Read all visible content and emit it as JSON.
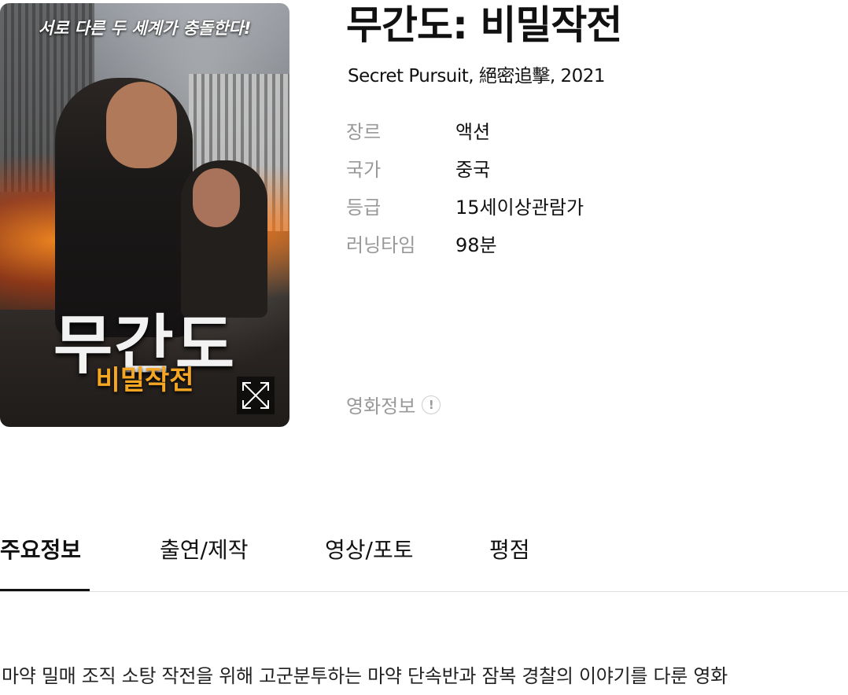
{
  "poster": {
    "tagline": "서로 다른 두 세계가 충돌한다!",
    "logo_main": "무간도",
    "logo_sub": "비밀작전"
  },
  "movie": {
    "title": "무간도: 비밀작전",
    "subtitle": "Secret Pursuit, 絕密追擊, 2021",
    "details": [
      {
        "label": "장르",
        "value": "액션"
      },
      {
        "label": "국가",
        "value": "중국"
      },
      {
        "label": "등급",
        "value": "15세이상관람가"
      },
      {
        "label": "러닝타임",
        "value": "98분"
      }
    ],
    "info_link": "영화정보",
    "info_icon": "!"
  },
  "tabs": [
    {
      "label": "주요정보",
      "active": true
    },
    {
      "label": "출연/제작",
      "active": false
    },
    {
      "label": "영상/포토",
      "active": false
    },
    {
      "label": "평점",
      "active": false
    }
  ],
  "synopsis": "마약 밀매 조직 소탕 작전을 위해 고군분투하는 마약 단속반과 잠복 경찰의 이야기를 다룬 영화"
}
